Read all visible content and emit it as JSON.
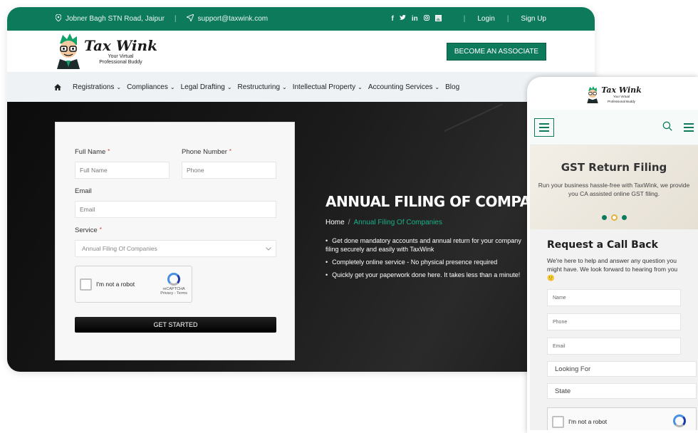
{
  "topbar": {
    "address": "Jobner Bagh STN Road, Jaipur",
    "email": "support@taxwink.com",
    "social_icons": [
      "facebook-icon",
      "twitter-icon",
      "linkedin-icon",
      "instagram-icon",
      "image-icon"
    ],
    "login": "Login",
    "signup": "Sign Up",
    "color": "#0e7a5c"
  },
  "brand": {
    "name": "Tax Wink",
    "tagline_1": "Your Virtual",
    "tagline_2": "Professional Buddy",
    "cta": "BECOME AN ASSOCIATE"
  },
  "nav": {
    "items": [
      {
        "label": "Registrations"
      },
      {
        "label": "Compliances"
      },
      {
        "label": "Legal Drafting"
      },
      {
        "label": "Restructuring"
      },
      {
        "label": "Intellectual Property"
      },
      {
        "label": "Accounting Services"
      },
      {
        "label": "Blog"
      }
    ],
    "caret": "⌄"
  },
  "form": {
    "full_name_label": "Full Name",
    "full_name_placeholder": "Full Name",
    "phone_label": "Phone Number",
    "phone_placeholder": "Phone",
    "email_label": "Email",
    "email_placeholder": "Email",
    "service_label": "Service",
    "service_value": "Annual Filing Of Companies",
    "required_mark": "*",
    "captcha_text": "I'm not a robot",
    "captcha_brand": "reCAPTCHA",
    "captcha_links": "Privacy - Terms",
    "submit": "GET STARTED"
  },
  "hero": {
    "title": "ANNUAL FILING OF COMPANIES",
    "breadcrumb_home": "Home",
    "breadcrumb_sep": "/",
    "breadcrumb_current": "Annual Filing Of Companies",
    "bullets": [
      "Get done mandatory accounts and annual return for your company filing securely and easily with TaxWink",
      "Completely online service - No physical presence required",
      "Quickly get your paperwork done here. It takes less than a minute!"
    ]
  },
  "mobile": {
    "hero_title": "GST Return Filing",
    "hero_text": "Run your business hassle-free with TaxWink, we provide you CA assisted online GST filing.",
    "callback_title": "Request a Call Back",
    "callback_text": "We're here to help and answer any question you might have. We look forward to hearing from you 🙂",
    "name_placeholder": "Name",
    "phone_placeholder": "Phone",
    "email_placeholder": "Email",
    "looking_for": "Looking For",
    "state": "State",
    "captcha_text": "I'm not a robot",
    "slider_active_index": 1
  }
}
